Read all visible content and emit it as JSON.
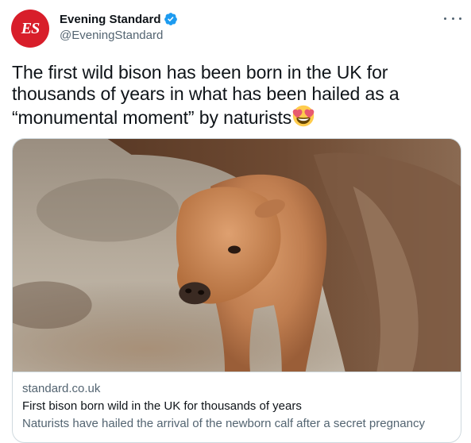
{
  "author": {
    "avatar_text": "ES",
    "display_name": "Evening Standard",
    "handle": "@EveningStandard",
    "verified": true
  },
  "tweet": {
    "text": "The first wild bison has been born in the UK for thousands of years in what has been hailed as a “monumental moment” by naturists",
    "emoji": "smiling-face-with-heart-eyes"
  },
  "card": {
    "domain": "standard.co.uk",
    "title": "First bison born wild in the UK for thousands of years",
    "description": "Naturists have hailed the arrival of the newborn calf after a secret pregnancy",
    "image_subject": "bison calf standing beside adult bison"
  },
  "colors": {
    "brand_red": "#d81e2a",
    "verified_blue": "#1d9bf0",
    "secondary_text": "#536471",
    "border": "#cfd9de"
  }
}
